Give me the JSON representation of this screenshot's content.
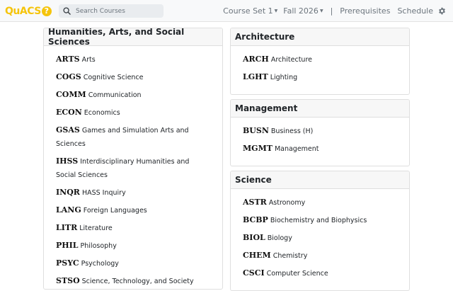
{
  "navbar": {
    "logo_text": "QuACS",
    "logo_badge": "?",
    "search_placeholder": "Search Courses",
    "course_set": "Course Set 1",
    "semester": "Fall 2026",
    "separator": "|",
    "prerequisites": "Prerequisites",
    "schedule": "Schedule"
  },
  "colors": {
    "brand": "#f5c40c",
    "nav_text": "#6c757d"
  },
  "schools": [
    {
      "name": "Humanities, Arts, and Social Sciences",
      "departments": [
        {
          "code": "ARTS",
          "name": "Arts"
        },
        {
          "code": "COGS",
          "name": "Cognitive Science"
        },
        {
          "code": "COMM",
          "name": "Communication"
        },
        {
          "code": "ECON",
          "name": "Economics"
        },
        {
          "code": "GSAS",
          "name": "Games and Simulation Arts and Sciences"
        },
        {
          "code": "IHSS",
          "name": "Interdisciplinary Humanities and Social Sciences"
        },
        {
          "code": "INQR",
          "name": "HASS Inquiry"
        },
        {
          "code": "LANG",
          "name": "Foreign Languages"
        },
        {
          "code": "LITR",
          "name": "Literature"
        },
        {
          "code": "PHIL",
          "name": "Philosophy"
        },
        {
          "code": "PSYC",
          "name": "Psychology"
        },
        {
          "code": "STSO",
          "name": "Science, Technology, and Society"
        }
      ]
    },
    {
      "name": "Architecture",
      "departments": [
        {
          "code": "ARCH",
          "name": "Architecture"
        },
        {
          "code": "LGHT",
          "name": "Lighting"
        }
      ]
    },
    {
      "name": "Management",
      "departments": [
        {
          "code": "BUSN",
          "name": "Business (H)"
        },
        {
          "code": "MGMT",
          "name": "Management"
        }
      ]
    },
    {
      "name": "Science",
      "departments": [
        {
          "code": "ASTR",
          "name": "Astronomy"
        },
        {
          "code": "BCBP",
          "name": "Biochemistry and Biophysics"
        },
        {
          "code": "BIOL",
          "name": "Biology"
        },
        {
          "code": "CHEM",
          "name": "Chemistry"
        },
        {
          "code": "CSCI",
          "name": "Computer Science"
        }
      ]
    }
  ]
}
